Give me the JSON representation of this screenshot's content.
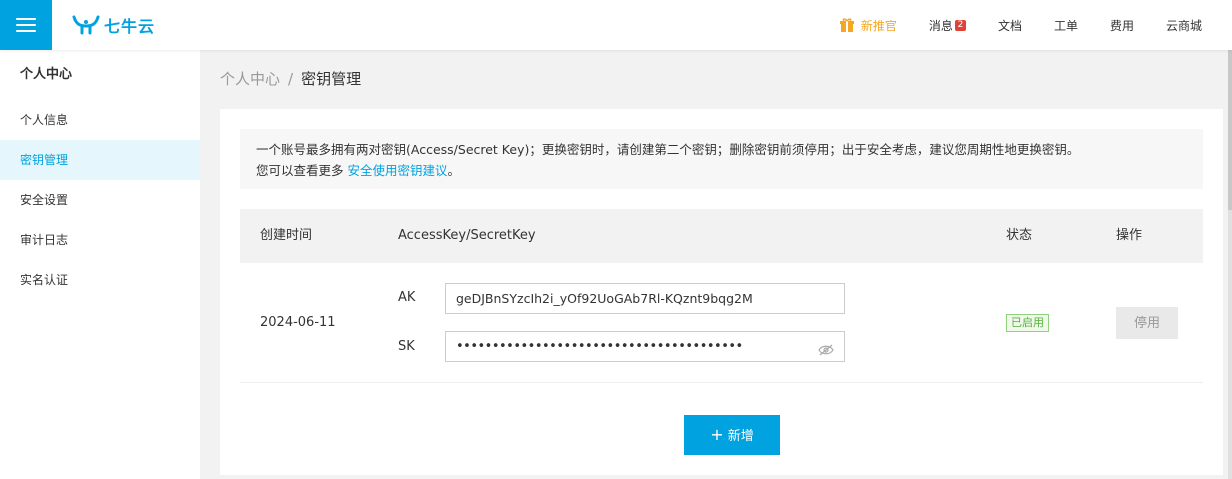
{
  "header": {
    "logo_text": "七牛云",
    "nav": [
      {
        "label": "新推官",
        "icon": "gift-icon"
      },
      {
        "label": "消息",
        "badge": "2"
      },
      {
        "label": "文档"
      },
      {
        "label": "工单"
      },
      {
        "label": "费用"
      },
      {
        "label": "云商城"
      }
    ]
  },
  "sidebar": {
    "title": "个人中心",
    "items": [
      {
        "label": "个人信息"
      },
      {
        "label": "密钥管理",
        "active": true
      },
      {
        "label": "安全设置"
      },
      {
        "label": "审计日志"
      },
      {
        "label": "实名认证"
      }
    ]
  },
  "breadcrumb": {
    "parent": "个人中心",
    "separator": "/",
    "current": "密钥管理"
  },
  "notice": {
    "line1": "一个账号最多拥有两对密钥(Access/Secret Key)；更换密钥时，请创建第二个密钥；删除密钥前须停用；出于安全考虑，建议您周期性地更换密钥。",
    "line2_prefix": "您可以查看更多",
    "link_text": "安全使用密钥建议",
    "line2_suffix": "。"
  },
  "table": {
    "headers": {
      "created": "创建时间",
      "key": "AccessKey/SecretKey",
      "status": "状态",
      "action": "操作"
    },
    "rows": [
      {
        "created": "2024-06-11",
        "ak_label": "AK",
        "ak_value": "geDJBnSYzcIh2i_yOf92UoGAb7Rl-KQznt9bqg2M",
        "sk_label": "SK",
        "sk_value": "••••••••••••••••••••••••••••••••••••••••",
        "status": "已启用",
        "action": "停用"
      }
    ]
  },
  "add_button": {
    "icon": "+",
    "label": "新增"
  },
  "colors": {
    "brand": "#00a3e0",
    "promo": "#f5a623",
    "badge": "#e0423a",
    "status_green": "#52b33a"
  }
}
